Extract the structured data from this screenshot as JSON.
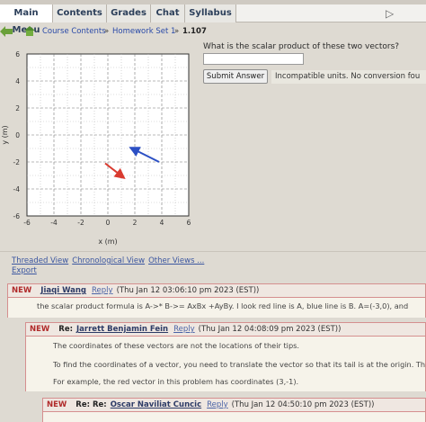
{
  "nav": {
    "items": [
      "Main Menu",
      "Contents",
      "Grades",
      "Chat",
      "Syllabus"
    ]
  },
  "breadcrumb": {
    "items": [
      "Course Contents",
      "Homework Set 1",
      "1.107"
    ],
    "separator": "»"
  },
  "problem": {
    "question": "What is the scalar product of these two vectors?",
    "answer_value": "",
    "submit_label": "Submit Answer",
    "feedback": "Incompatible units. No conversion fou"
  },
  "graph": {
    "x_ticks": [
      "-6",
      "-4",
      "-2",
      "0",
      "2",
      "4",
      "6"
    ],
    "y_ticks": [
      "6",
      "4",
      "2",
      "0",
      "-2",
      "-4",
      "-6"
    ],
    "xlabel": "x (m)",
    "ylabel": "y (m)",
    "xlim": [
      -6,
      6
    ],
    "ylim": [
      -6,
      6
    ],
    "red_vector": {
      "color": "#d93a2f",
      "x1": -0.2,
      "y1": -2.1,
      "x2": 1.1,
      "y2": -3.1
    },
    "blue_vector": {
      "color": "#2b4fc4",
      "x1": 3.8,
      "y1": -2.0,
      "x2": 1.8,
      "y2": -1.0
    }
  },
  "discussion": {
    "links": [
      "Threaded View",
      "Chronological View",
      "Other Views ...",
      "Export"
    ],
    "posts": [
      {
        "new": "NEW",
        "prefix": "",
        "author": "Jiaqi Wang",
        "reply": "Reply",
        "timestamp": "(Thu Jan 12 03:06:10 pm 2023 (EST))",
        "lines": [
          "the scalar product formula is A->* B->= AxBx +AyBy. I look red line is A, blue line is B. A=(-3,0), and"
        ]
      },
      {
        "new": "NEW",
        "prefix": "Re:",
        "author": "Jarrett Benjamin Fein",
        "reply": "Reply",
        "timestamp": "(Thu Jan 12 04:08:09 pm 2023 (EST))",
        "lines": [
          "The coordinates of these vectors are not the locations of their tips.",
          "To find the coordinates of a vector, you need to translate the vector so that its tail is at the origin. Th",
          "For example, the red vector in this problem has coordinates (3,-1)."
        ]
      },
      {
        "new": "NEW",
        "prefix": "Re: Re:",
        "author": "Oscar Naviliat Cuncic",
        "reply": "Reply",
        "timestamp": "(Thu Jan 12 04:50:10 pm 2023 (EST))",
        "lines": []
      }
    ]
  }
}
